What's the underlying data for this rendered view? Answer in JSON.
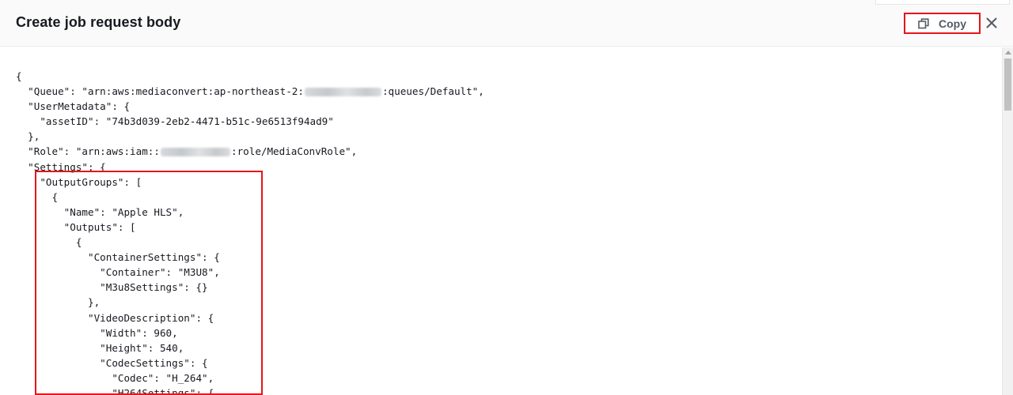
{
  "dialog": {
    "title": "Create job request body",
    "copy_label": "Copy",
    "copy_icon": "copy-icon",
    "close_icon": "close-icon"
  },
  "code_lines": [
    {
      "segments": [
        {
          "t": "{"
        }
      ]
    },
    {
      "segments": [
        {
          "t": "  \"Queue\": \"arn:aws:mediaconvert:ap-northeast-2:"
        },
        {
          "redacted": true,
          "w": 97
        },
        {
          "t": ":queues/Default\","
        }
      ]
    },
    {
      "segments": [
        {
          "t": "  \"UserMetadata\": {"
        }
      ]
    },
    {
      "segments": [
        {
          "t": "    \"assetID\": \"74b3d039-2eb2-4471-b51c-9e6513f94ad9\""
        }
      ]
    },
    {
      "segments": [
        {
          "t": "  },"
        }
      ]
    },
    {
      "segments": [
        {
          "t": "  \"Role\": \"arn:aws:iam::"
        },
        {
          "redacted": true,
          "w": 88
        },
        {
          "t": ":role/MediaConvRole\","
        }
      ]
    },
    {
      "segments": [
        {
          "t": "  \"Settings\": {"
        }
      ]
    },
    {
      "segments": [
        {
          "t": "    \"OutputGroups\": ["
        }
      ]
    },
    {
      "segments": [
        {
          "t": "      {"
        }
      ]
    },
    {
      "segments": [
        {
          "t": "        \"Name\": \"Apple HLS\","
        }
      ]
    },
    {
      "segments": [
        {
          "t": "        \"Outputs\": ["
        }
      ]
    },
    {
      "segments": [
        {
          "t": "          {"
        }
      ]
    },
    {
      "segments": [
        {
          "t": "            \"ContainerSettings\": {"
        }
      ]
    },
    {
      "segments": [
        {
          "t": "              \"Container\": \"M3U8\","
        }
      ]
    },
    {
      "segments": [
        {
          "t": "              \"M3u8Settings\": {}"
        }
      ]
    },
    {
      "segments": [
        {
          "t": "            },"
        }
      ]
    },
    {
      "segments": [
        {
          "t": "            \"VideoDescription\": {"
        }
      ]
    },
    {
      "segments": [
        {
          "t": "              \"Width\": 960,"
        }
      ]
    },
    {
      "segments": [
        {
          "t": "              \"Height\": 540,"
        }
      ]
    },
    {
      "segments": [
        {
          "t": "              \"CodecSettings\": {"
        }
      ]
    },
    {
      "segments": [
        {
          "t": "                \"Codec\": \"H_264\","
        }
      ]
    },
    {
      "segments": [
        {
          "t": "                \"H264Settings\": {"
        }
      ]
    }
  ],
  "colors": {
    "highlight": "#e4161b",
    "header_bg": "#fafafa",
    "text": "#16191f"
  }
}
